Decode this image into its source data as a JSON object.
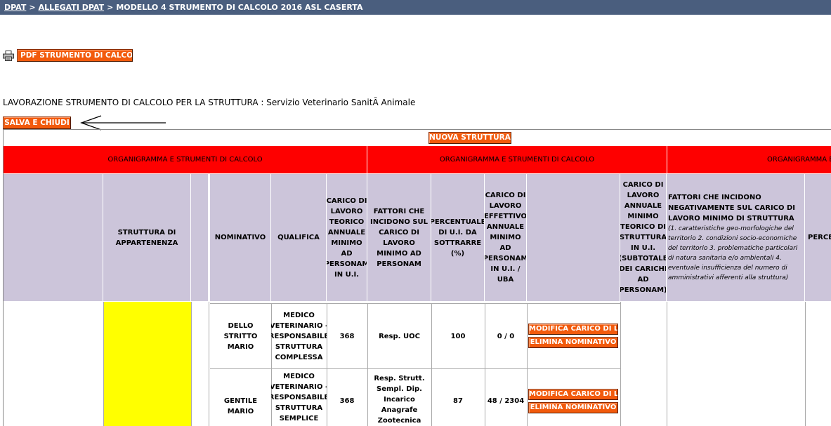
{
  "breadcrumb": {
    "dpat": "DPAT",
    "allegati": "ALLEGATI DPAT",
    "current": "MODELLO 4 STRUMENTO DI CALCOLO 2016 ASL CASERTA",
    "separator": ">"
  },
  "actions": {
    "pdf_label": "PDF STRUMENTO DI CALCOLO",
    "save_label": "SALVA E CHIUDI",
    "new_structure_label": "NUOVA STRUTTURA"
  },
  "heading": {
    "prefix": "LAVORAZIONE STRUMENTO DI CALCOLO PER LA STRUTTURA :",
    "structure": "Servizio Veterinario SanitÃ  Animale"
  },
  "table": {
    "group_headers": [
      "ORGANIGRAMMA E STRUMENTI DI CALCOLO",
      "ORGANIGRAMMA E STRUMENTI DI CALCOLO",
      "ORGANIGRAMMA E STRUMENTI DI CALCOLO"
    ],
    "columns": {
      "struttura": "STRUTTURA DI APPARTENENZA",
      "nominativo": "NOMINATIVO",
      "qualifica": "QUALIFICA",
      "carico_teorico": "CARICO DI LAVORO TEORICO ANNUALE MINIMO AD PERSONAM IN U.I.",
      "fattori": "FATTORI CHE INCIDONO SUL CARICO DI LAVORO MINIMO AD PERSONAM",
      "percentuale": "PERCENTUALE DI U.I. DA SOTTRARRE (%)",
      "carico_effettivo": "CARICO DI LAVORO EFFETTIVO ANNUALE MINIMO AD PERSONAM IN U.I. / UBA",
      "carico_struttura": "CARICO DI LAVORO ANNUALE MINIMO TEORICO DI STRUTTURA IN U.I. (SUBTOTALE DEI CARICHI AD PERSONAM)",
      "fattori_struttura": "FATTORI CHE INCIDONO NEGATIVAMENTE SUL CARICO DI LAVORO MINIMO DI STRUTTURA",
      "fattori_struttura_note": "(1. caratteristiche geo-morfologiche del territorio 2. condizioni socio-economiche del territorio 3. problematiche particolari di natura sanitaria e/o ambientali 4. eventuale insufficienza del numero di amministrativi afferenti alla struttura)",
      "percentuale_cut": "PERCENTUALE DA SOTTRARRE"
    },
    "rows": [
      {
        "nominativo": "DELLO STRITTO MARIO",
        "qualifica": "MEDICO VETERINARIO - RESPONSABILE STRUTTURA COMPLESSA",
        "carico": "368",
        "fattori": "Resp. UOC",
        "percentuale": "100",
        "effettivo": "0 / 0",
        "modify_label": "MODIFICA CARICO DI LAVORO",
        "delete_label": "ELIMINA NOMINATIVO"
      },
      {
        "nominativo": "GENTILE MARIO",
        "qualifica": "MEDICO VETERINARIO - RESPONSABILE STRUTTURA SEMPLICE",
        "carico": "368",
        "fattori": "Resp. Strutt. Sempl. Dip. Incarico Anagrafe Zootecnica",
        "percentuale": "87",
        "effettivo": "48 / 2304",
        "modify_label": "MODIFICA CARICO DI LAVORO",
        "delete_label": "ELIMINA NOMINATIVO"
      }
    ]
  },
  "icons": {
    "printer": "printer-icon",
    "arrow": "arrow-left-icon"
  },
  "colors": {
    "topbar": "#4a5e7e",
    "button": "#f25a0c",
    "group_header": "#fe0000",
    "header_bg": "#ccc5da",
    "highlight": "#ffff00"
  }
}
